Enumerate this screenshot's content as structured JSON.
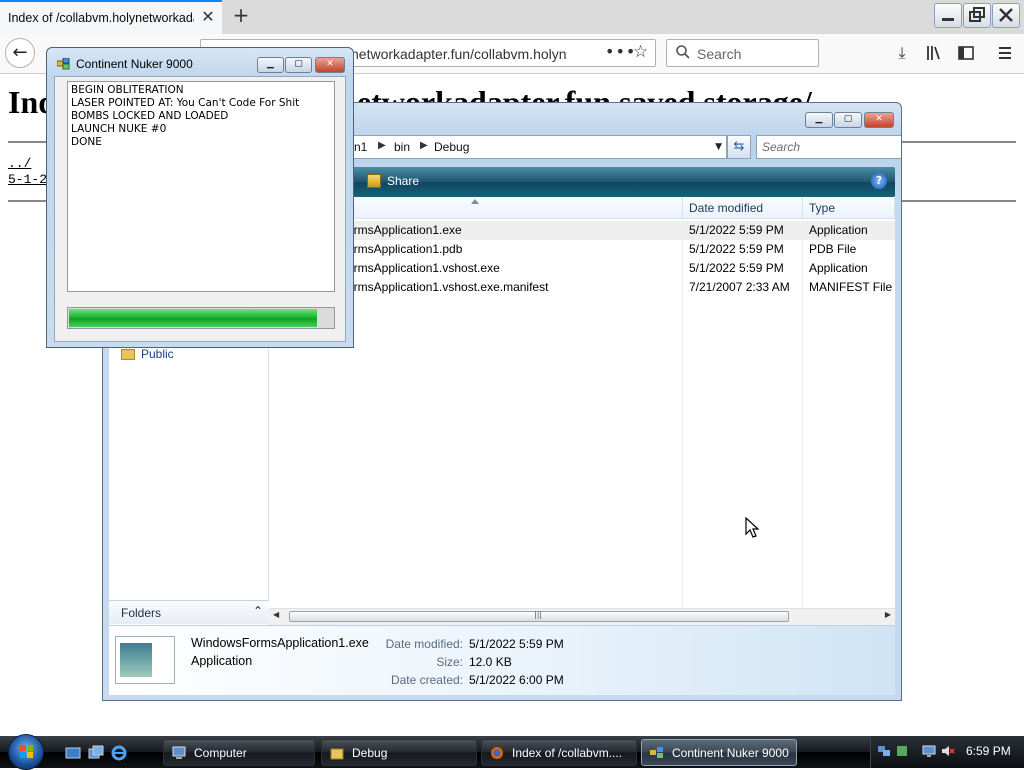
{
  "browser": {
    "tab_title": "Index of /collabvm.holynetworkadapter.fun/saved storage/",
    "url_visible": "networkadapter.fun/collabvm.holyn",
    "search_placeholder": "Search",
    "window_controls": [
      "minimize-icon",
      "restore-icon",
      "close-icon"
    ],
    "toolbar_icons": [
      "download-icon",
      "library-icon",
      "sidebar-icon",
      "menu-icon"
    ]
  },
  "page": {
    "heading_left": "Ind",
    "heading_right": "etworkadapter.fun saved storage/",
    "links": [
      "../",
      "5-1-2"
    ]
  },
  "explorer": {
    "breadcrumbs": [
      "n1",
      "bin",
      "Debug"
    ],
    "search_placeholder": "Search",
    "share_label": "Share",
    "help_label": "?",
    "columns": {
      "name": "",
      "date": "Date modified",
      "type": "Type"
    },
    "files": [
      {
        "name": "ormsApplication1.exe",
        "date": "5/1/2022 5:59 PM",
        "type": "Application",
        "selected": true
      },
      {
        "name": "ormsApplication1.pdb",
        "date": "5/1/2022 5:59 PM",
        "type": "PDB File",
        "selected": false
      },
      {
        "name": "ormsApplication1.vshost.exe",
        "date": "5/1/2022 5:59 PM",
        "type": "Application",
        "selected": false
      },
      {
        "name": "ormsApplication1.vshost.exe.manifest",
        "date": "7/21/2007 2:33 AM",
        "type": "MANIFEST File",
        "selected": false
      }
    ],
    "nav_public": "Public",
    "folders_label": "Folders",
    "details": {
      "name": "WindowsFormsApplication1.exe",
      "type": "Application",
      "date_modified_label": "Date modified:",
      "date_modified": "5/1/2022 5:59 PM",
      "size_label": "Size:",
      "size": "12.0 KB",
      "date_created_label": "Date created:",
      "date_created": "5/1/2022 6:00 PM"
    }
  },
  "nuker": {
    "title": "Continent Nuker 9000",
    "log": [
      "BEGIN OBLITERATION",
      "LASER POINTED AT: You Can't Code For Shit",
      "BOMBS LOCKED AND LOADED",
      "LAUNCH NUKE #0",
      "DONE"
    ],
    "progress": 0.94
  },
  "taskbar": {
    "items": [
      {
        "label": "Computer",
        "icon": "computer-icon",
        "active": false
      },
      {
        "label": "Debug",
        "icon": "folder-icon",
        "active": false
      },
      {
        "label": "Index of /collabvm....",
        "icon": "firefox-icon",
        "active": false
      },
      {
        "label": "Continent Nuker 9000",
        "icon": "app-icon",
        "active": true
      }
    ],
    "clock": "6:59 PM"
  },
  "colors": {
    "accent_tab": "#0a84ff",
    "explorer_cmdbar": "#1d566e",
    "progress_green": "#1db536",
    "taskbar": "#15191e"
  }
}
